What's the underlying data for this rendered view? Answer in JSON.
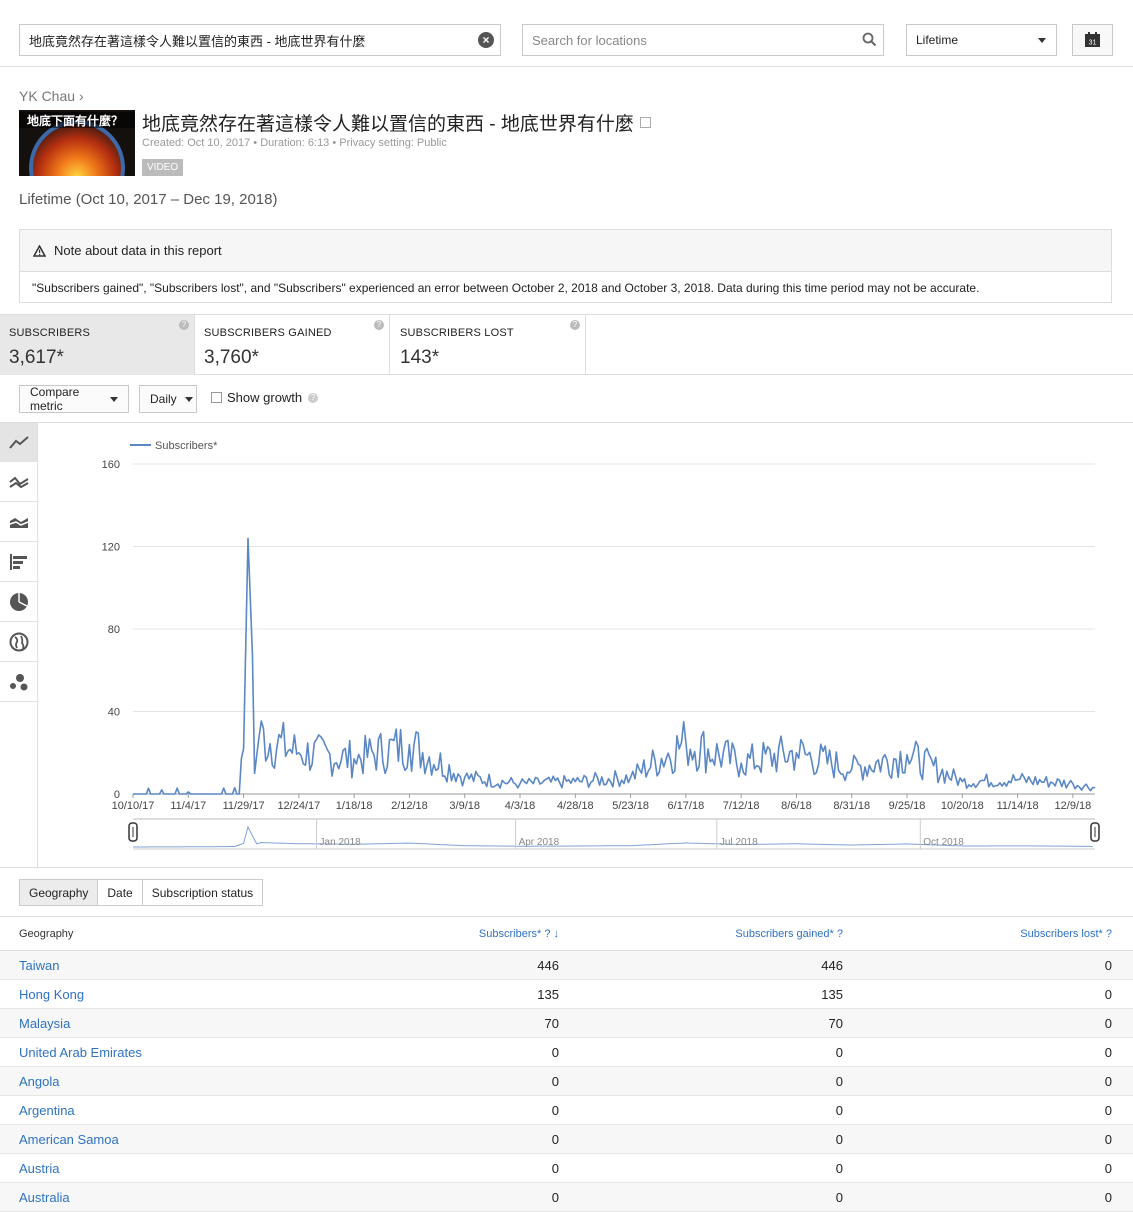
{
  "header": {
    "video_search_value": "地底竟然存在著這樣令人難以置信的東西 - 地底世界有什麼",
    "location_search_placeholder": "Search for locations",
    "range_select_value": "Lifetime",
    "calendar_label": "31"
  },
  "video": {
    "channel": "YK Chau",
    "thumbnail_text": "地底下面有什麼？",
    "title": "地底竟然存在著這樣令人難以置信的東西 - 地底世界有什麼",
    "created": "Created: Oct 10, 2017",
    "duration": "Duration: 6:13",
    "privacy": "Privacy setting: Public",
    "badge": "VIDEO",
    "range_heading": "Lifetime (Oct 10, 2017 – Dec 19, 2018)"
  },
  "note": {
    "title": "Note about data in this report",
    "body": "\"Subscribers gained\", \"Subscribers lost\", and \"Subscribers\" experienced an error between October 2, 2018 and October 3, 2018. Data during this time period may not be accurate."
  },
  "metrics": [
    {
      "label": "SUBSCRIBERS",
      "value": "3,617*"
    },
    {
      "label": "SUBSCRIBERS GAINED",
      "value": "3,760*"
    },
    {
      "label": "SUBSCRIBERS LOST",
      "value": "143*"
    }
  ],
  "controls": {
    "compare_metric": "Compare metric",
    "granularity": "Daily",
    "show_growth": "Show growth"
  },
  "chart_icons": [
    "line-chart-icon",
    "multi-line-icon",
    "stacked-area-icon",
    "bar-chart-icon",
    "pie-chart-icon",
    "globe-icon",
    "bubble-chart-icon"
  ],
  "chart_data": {
    "type": "line",
    "series": [
      {
        "name": "Subscribers*",
        "color": "#5b87c5"
      }
    ],
    "ylim": [
      0,
      160
    ],
    "yticks": [
      "160",
      "120",
      "80",
      "40",
      "0"
    ],
    "x_tick_labels": [
      "10/10/17",
      "11/4/17",
      "11/29/17",
      "12/24/17",
      "1/18/18",
      "2/12/18",
      "3/9/18",
      "4/3/18",
      "4/28/18",
      "5/23/18",
      "6/17/18",
      "7/12/18",
      "8/6/18",
      "8/31/18",
      "9/25/18",
      "10/20/18",
      "11/14/18",
      "12/9/18"
    ],
    "x_start": "10/10/17",
    "x_end": "12/19/18",
    "timeline_labels": [
      "Jan 2018",
      "Apr 2018",
      "Jul 2018",
      "Oct 2018"
    ],
    "key_points": [
      {
        "x": "10/10/17",
        "y": 0
      },
      {
        "x": "11/4/17",
        "y": 1
      },
      {
        "x": "11/25/17",
        "y": 3
      },
      {
        "x": "11/29/17",
        "y": 22
      },
      {
        "x": "12/1/17",
        "y": 124
      },
      {
        "x": "12/3/17",
        "y": 68
      },
      {
        "x": "12/4/17",
        "y": 10
      },
      {
        "x": "12/6/17",
        "y": 28
      },
      {
        "x": "12/24/17",
        "y": 20
      },
      {
        "x": "1/18/18",
        "y": 17
      },
      {
        "x": "2/12/18",
        "y": 24
      },
      {
        "x": "3/9/18",
        "y": 8
      },
      {
        "x": "4/3/18",
        "y": 5
      },
      {
        "x": "4/28/18",
        "y": 6
      },
      {
        "x": "5/23/18",
        "y": 8
      },
      {
        "x": "6/17/18",
        "y": 25
      },
      {
        "x": "7/12/18",
        "y": 15
      },
      {
        "x": "8/6/18",
        "y": 20
      },
      {
        "x": "8/31/18",
        "y": 12
      },
      {
        "x": "9/25/18",
        "y": 19
      },
      {
        "x": "10/20/18",
        "y": 6
      },
      {
        "x": "11/14/18",
        "y": 7
      },
      {
        "x": "12/9/18",
        "y": 5
      },
      {
        "x": "12/19/18",
        "y": 3
      }
    ]
  },
  "table_tabs": [
    "Geography",
    "Date",
    "Subscription status"
  ],
  "table": {
    "headers": [
      "Geography",
      "Subscribers* ? ↓",
      "Subscribers gained* ?",
      "Subscribers lost* ?"
    ],
    "rows": [
      [
        "Taiwan",
        "446",
        "446",
        "0"
      ],
      [
        "Hong Kong",
        "135",
        "135",
        "0"
      ],
      [
        "Malaysia",
        "70",
        "70",
        "0"
      ],
      [
        "United Arab Emirates",
        "0",
        "0",
        "0"
      ],
      [
        "Angola",
        "0",
        "0",
        "0"
      ],
      [
        "Argentina",
        "0",
        "0",
        "0"
      ],
      [
        "American Samoa",
        "0",
        "0",
        "0"
      ],
      [
        "Austria",
        "0",
        "0",
        "0"
      ],
      [
        "Australia",
        "0",
        "0",
        "0"
      ]
    ]
  }
}
